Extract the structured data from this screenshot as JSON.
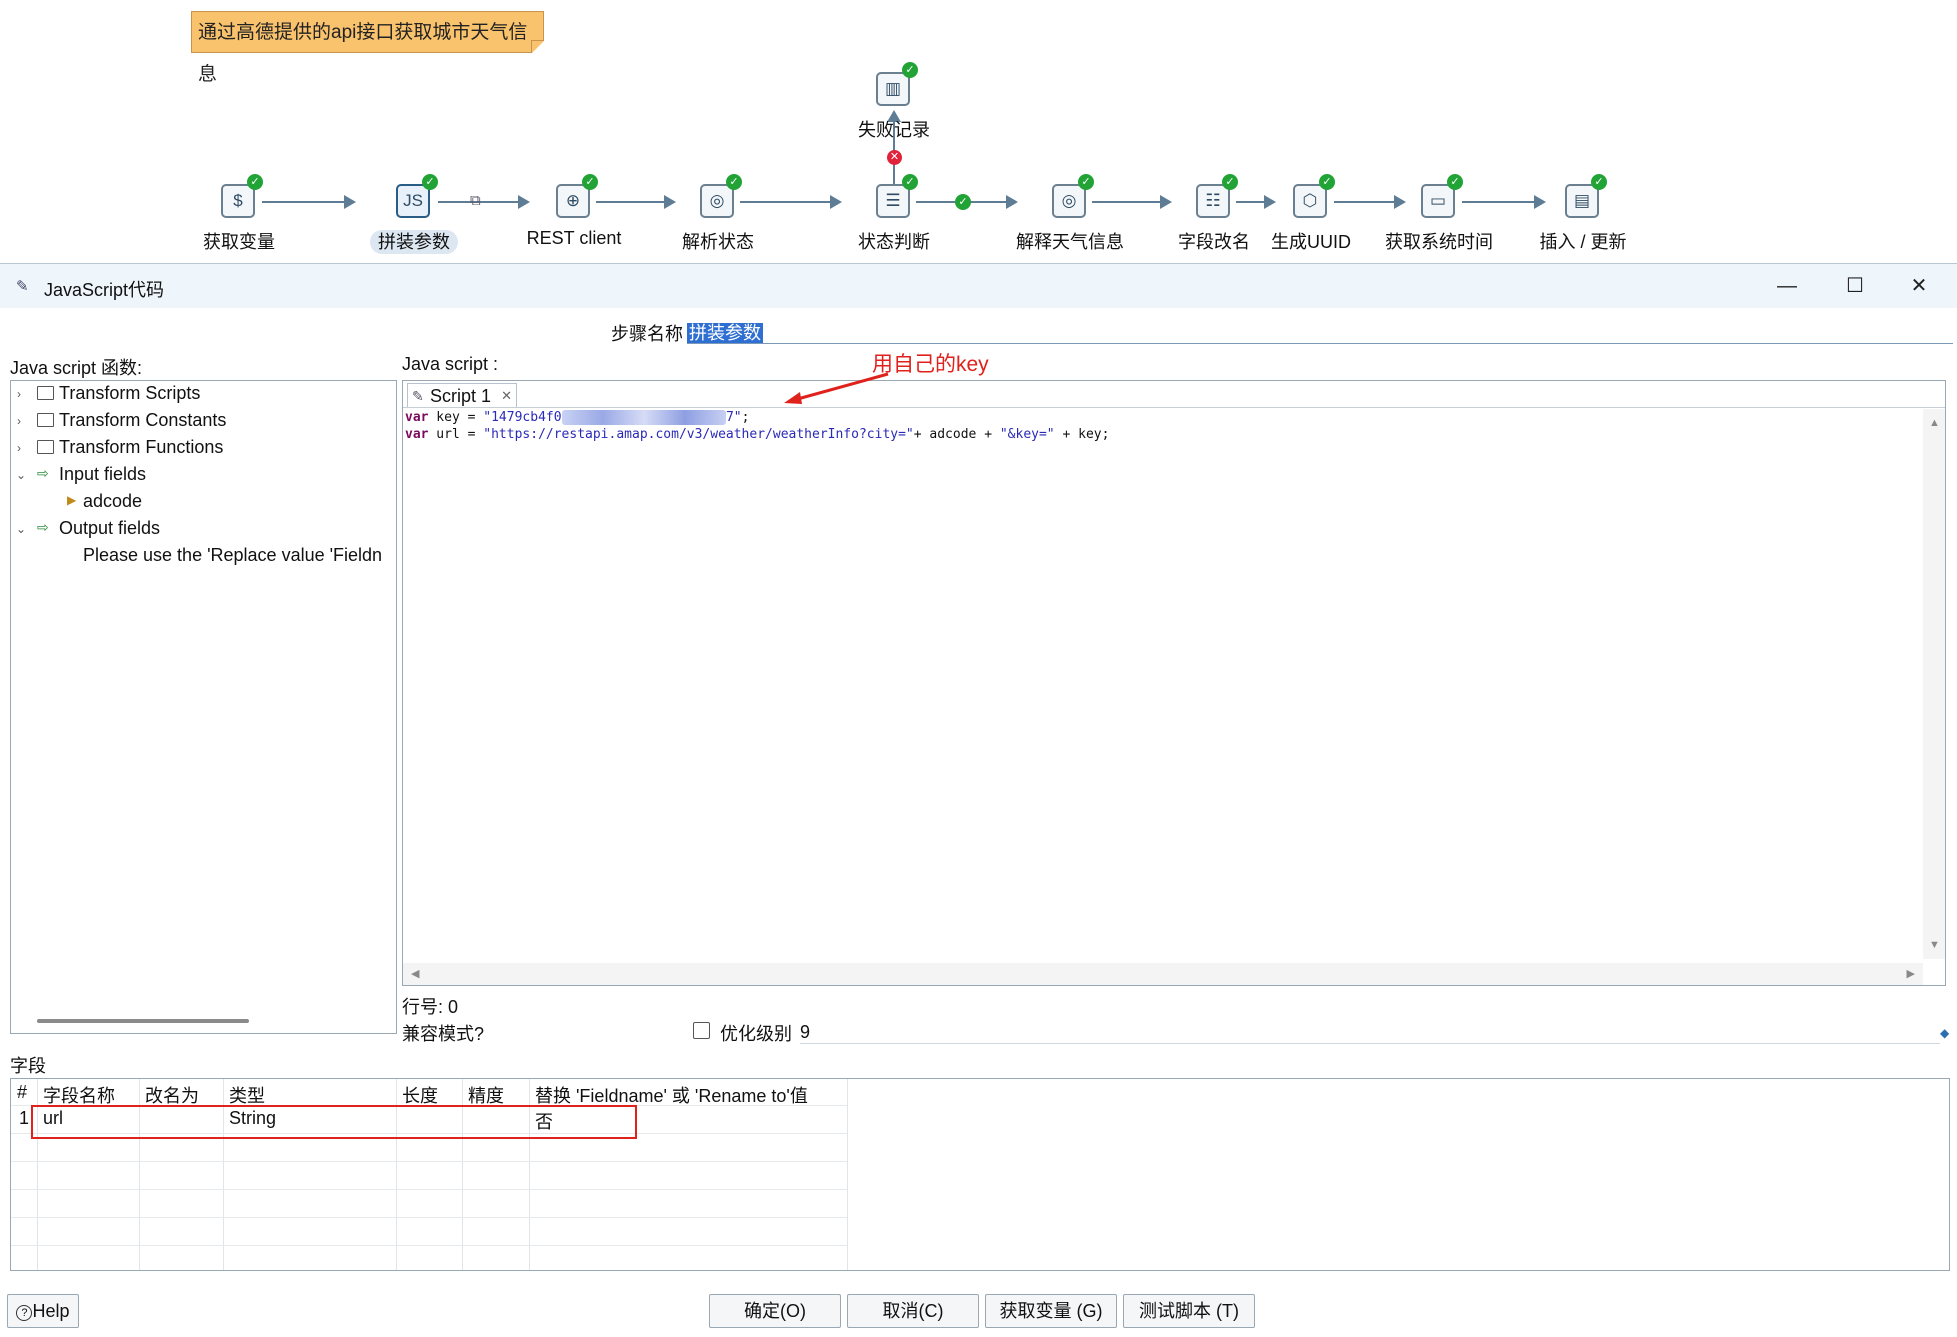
{
  "canvas": {
    "note": "通过高德提供的api接口获取城市天气信息",
    "steps": [
      {
        "label": "获取变量",
        "icon": "dollar-icon"
      },
      {
        "label": "拼装参数",
        "icon": "javascript-icon"
      },
      {
        "label": "REST client",
        "icon": "rest-client-icon"
      },
      {
        "label": "解析状态",
        "icon": "json-input-icon"
      },
      {
        "label": "状态判断",
        "icon": "filter-icon"
      },
      {
        "label": "解释天气信息",
        "icon": "json-input-icon"
      },
      {
        "label": "字段改名",
        "icon": "select-values-icon"
      },
      {
        "label": "生成UUID",
        "icon": "uuid-icon"
      },
      {
        "label": "获取系统时间",
        "icon": "system-info-icon"
      },
      {
        "label": "插入 / 更新",
        "icon": "insert-update-icon"
      }
    ],
    "failure_step": {
      "label": "失败记录",
      "icon": "log-icon"
    }
  },
  "dialog": {
    "title": "JavaScript代码",
    "step_name_label": "步骤名称",
    "step_name_value": "拼装参数",
    "functions_label": "Java script 函数:",
    "script_label": "Java script :",
    "tree": [
      {
        "label": "Transform Scripts"
      },
      {
        "label": "Transform Constants"
      },
      {
        "label": "Transform Functions"
      },
      {
        "label": "Input fields"
      },
      {
        "label": "adcode"
      },
      {
        "label": "Output fields"
      },
      {
        "label": "Please use the 'Replace value 'Fieldn"
      }
    ],
    "tab_label": "Script 1",
    "code": {
      "line1_kw": "var",
      "line1_var": " key = ",
      "line1_str_a": "\"1479cb4f0",
      "line1_str_b": "7\"",
      "line1_end": ";",
      "line2_kw": "var",
      "line2_var": " url = ",
      "line2_str": "\"https://restapi.amap.com/v3/weather/weatherInfo?city=\"",
      "line2_rest": "+ adcode + ",
      "line2_str2": "\"&key=\"",
      "line2_end": " + key;"
    },
    "annotation": "用自己的key",
    "line_number_label": "行号: 0",
    "compat_label": "兼容模式?",
    "optimize_label": "优化级别",
    "optimize_value": "9",
    "fields_label": "字段",
    "table": {
      "headers": [
        "#",
        "字段名称",
        "改名为",
        "类型",
        "长度",
        "精度",
        "替换 'Fieldname' 或 'Rename to'值"
      ],
      "rows": [
        {
          "num": "1",
          "name": "url",
          "rename": "",
          "type": "String",
          "length": "",
          "precision": "",
          "replace": "否"
        }
      ]
    },
    "buttons": {
      "help": "Help",
      "ok": "确定(O)",
      "cancel": "取消(C)",
      "get_vars": "获取变量 (G)",
      "test": "测试脚本 (T)"
    }
  },
  "colors": {
    "note_bg": "#f9c26d",
    "annotation": "#e0221d",
    "selection": "#2f6fd1",
    "ok_badge": "#22a336"
  }
}
